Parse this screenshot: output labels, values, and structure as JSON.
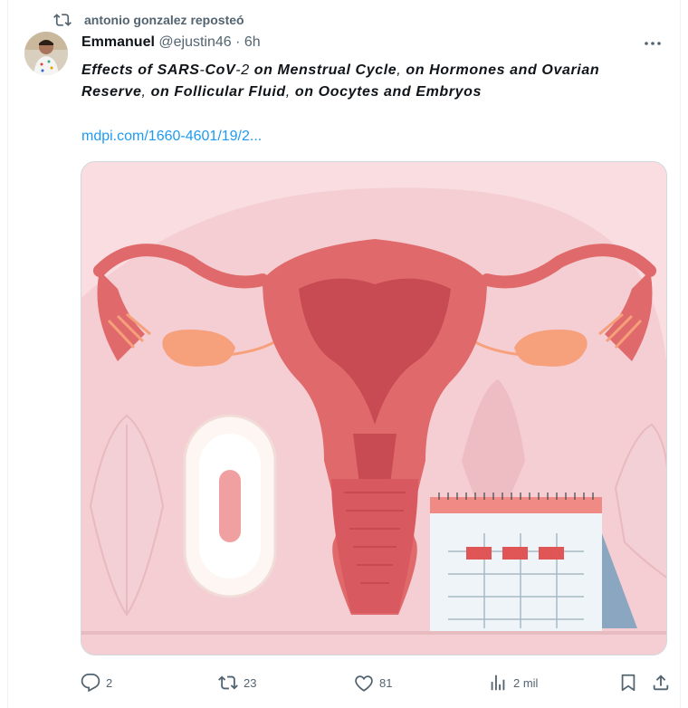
{
  "repost": {
    "text": "antonio gonzalez reposteó",
    "icon": "repost-icon"
  },
  "author": {
    "name": "Emmanuel",
    "handle": "@ejustin46",
    "separator": "·",
    "time": "6h"
  },
  "tweet": {
    "text_parts": [
      {
        "text": "Effects of SARS",
        "kind": "i"
      },
      {
        "text": "-",
        "kind": "n"
      },
      {
        "text": "CoV",
        "kind": "i"
      },
      {
        "text": "-2 ",
        "kind": "n"
      },
      {
        "text": "on Menstrual Cycle",
        "kind": "i"
      },
      {
        "text": ", ",
        "kind": "n"
      },
      {
        "text": "on Hormones and Ovarian Reserve",
        "kind": "i"
      },
      {
        "text": ", ",
        "kind": "n"
      },
      {
        "text": "on Follicular Fluid",
        "kind": "i"
      },
      {
        "text": ", ",
        "kind": "n"
      },
      {
        "text": "on Oocytes and Embryos",
        "kind": "i"
      }
    ],
    "link": "mdpi.com/1660-4601/19/2..."
  },
  "media": {
    "alt": "uterus illustration with pad and calendar"
  },
  "actions": {
    "replies": "2",
    "reposts": "23",
    "likes": "81",
    "views": "2 mil"
  },
  "colors": {
    "accent": "#1d9bf0",
    "muted": "#536471",
    "uterus": "#e06a6b"
  }
}
